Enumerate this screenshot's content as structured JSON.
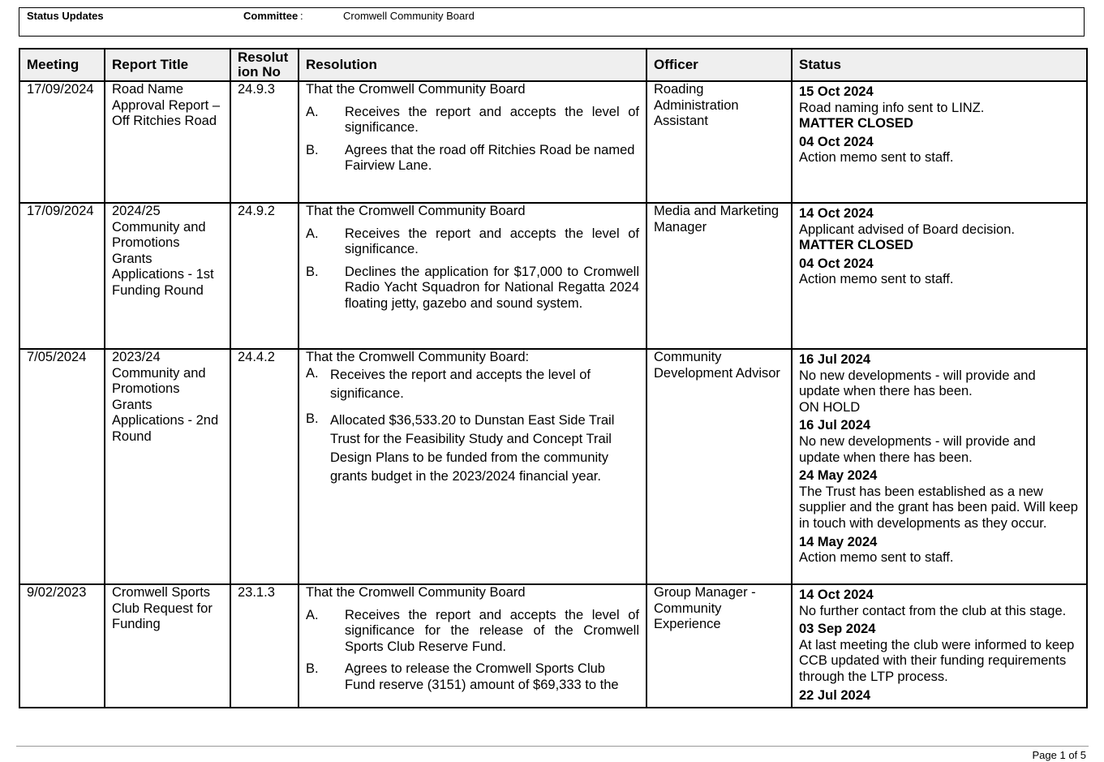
{
  "header": {
    "status_label": "Status Updates",
    "committee_label": "Committee",
    "committee_colon": ":",
    "committee_value": "Cromwell Community Board"
  },
  "table": {
    "columns": [
      "Meeting",
      "Report Title",
      "Resolut ion No",
      "Resolution",
      "Officer",
      "Status"
    ],
    "rows": [
      {
        "meeting": "17/09/2024",
        "title": "Road Name Approval Report – Off Ritchies Road",
        "res_no": "24.9.3",
        "res_intro": "That the Cromwell Community Board",
        "res_items": [
          {
            "letter": "A.",
            "text": "Receives the report and accepts the level of significance."
          },
          {
            "letter": "B.",
            "text": "Agrees that the road off Ritchies Road be named Fairview Lane."
          }
        ],
        "officer": "Roading Administration Assistant",
        "status": [
          {
            "date": "15 Oct 2024",
            "text": "Road naming info sent to LINZ.",
            "extra": "MATTER CLOSED"
          },
          {
            "date": "04 Oct 2024",
            "text": "Action memo sent to staff."
          }
        ]
      },
      {
        "meeting": "17/09/2024",
        "title": "2024/25 Community and Promotions Grants Applications - 1st Funding Round",
        "res_no": "24.9.2",
        "res_intro": "That the Cromwell Community Board",
        "res_items": [
          {
            "letter": "A.",
            "text": "Receives the report and accepts the level of significance."
          },
          {
            "letter": "B.",
            "text": "Declines the application for $17,000 to Cromwell Radio Yacht Squadron for National Regatta 2024 floating jetty, gazebo and sound system."
          }
        ],
        "officer": "Media and Marketing Manager",
        "status": [
          {
            "date": "14 Oct 2024",
            "text": "Applicant advised of Board decision.",
            "extra": "MATTER CLOSED"
          },
          {
            "date": "04 Oct 2024",
            "text": "Action memo sent to staff."
          }
        ]
      },
      {
        "meeting": "7/05/2024",
        "title": "2023/24 Community and Promotions Grants Applications - 2nd Round",
        "res_no": "24.4.2",
        "res_intro": "That the Cromwell Community Board:",
        "res_items": [
          {
            "letter": "A.",
            "text": "Receives the report and accepts the level of significance."
          },
          {
            "letter": "B.",
            "text": "Allocated $36,533.20 to Dunstan East Side Trail Trust for the Feasibility Study and Concept Trail Design Plans to be funded from the community grants budget in the 2023/2024 financial year."
          }
        ],
        "officer": "Community Development Advisor",
        "status": [
          {
            "date": "16 Jul 2024",
            "text": "No new developments - will provide and update when there has been.",
            "plain": "ON HOLD"
          },
          {
            "date": "16 Jul 2024",
            "text": "No new developments - will provide and update when there has been."
          },
          {
            "date": "24 May 2024",
            "text": "The Trust has been established as a new supplier and the grant has been paid.  Will keep in touch with developments as they occur."
          },
          {
            "date": "14 May 2024",
            "text": "Action memo sent to staff."
          }
        ]
      },
      {
        "meeting": "9/02/2023",
        "title": "Cromwell Sports Club Request for Funding",
        "res_no": "23.1.3",
        "res_intro": "That the Cromwell Community Board",
        "res_items": [
          {
            "letter": "A.",
            "text": "Receives the report and accepts the level of significance for the release of the Cromwell Sports Club Reserve Fund."
          },
          {
            "letter": "B.",
            "text": "Agrees to release the Cromwell Sports Club Fund reserve (3151) amount of $69,333 to the"
          }
        ],
        "officer": "Group Manager - Community Experience",
        "status": [
          {
            "date": "14 Oct 2024",
            "text": "No further contact from the club at this stage."
          },
          {
            "date": "03 Sep 2024",
            "text": "At last meeting the club were informed to keep CCB updated with their funding requirements through the LTP process."
          },
          {
            "date": "22 Jul 2024",
            "text": ""
          }
        ]
      }
    ]
  },
  "footer": {
    "page_label": "Page 1 of 5"
  }
}
